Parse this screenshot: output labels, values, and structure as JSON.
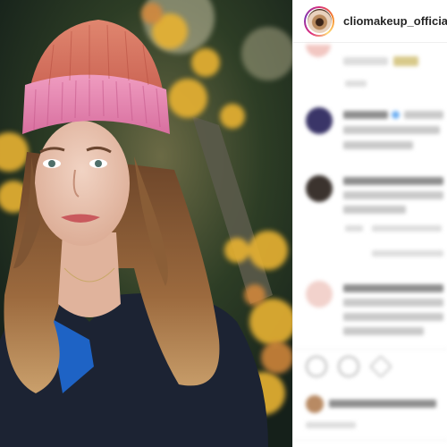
{
  "post": {
    "username": "cliomakeup_official",
    "verified": true
  },
  "photo": {
    "subject": "woman-with-pink-beanie"
  },
  "icons": {
    "verified": "verified-badge-icon",
    "like": "heart-icon",
    "comment": "comment-icon",
    "share": "share-icon"
  },
  "colors": {
    "verified_blue": "#3897f0",
    "story_ring": "#d92e7f"
  }
}
